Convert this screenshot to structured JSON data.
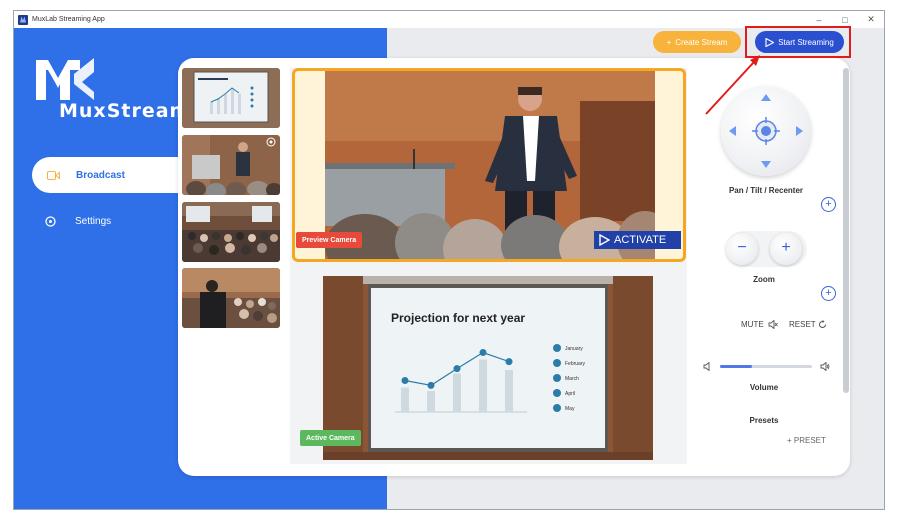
{
  "window": {
    "title": "MuxLab Streaming App",
    "controls": [
      "–",
      "□",
      "✕"
    ]
  },
  "brand": {
    "logo_text": "MuxStream"
  },
  "sidebar": {
    "items": [
      {
        "label": "Broadcast",
        "icon": "video-camera-icon",
        "active": true
      },
      {
        "label": "Settings",
        "icon": "settings-icon",
        "active": false
      }
    ]
  },
  "toolbar": {
    "create_label": "Create Stream",
    "start_label": "Start Streaming"
  },
  "preview": {
    "tag": "Preview Camera",
    "activate_label": "ACTIVATE"
  },
  "active": {
    "tag": "Active Camera"
  },
  "slide": {
    "title": "Projection for next year",
    "legend": [
      "January",
      "February",
      "March",
      "April",
      "May"
    ],
    "bars": [
      0.35,
      0.3,
      0.55,
      0.75,
      0.6
    ],
    "line": [
      0.45,
      0.38,
      0.62,
      0.85,
      0.72
    ]
  },
  "controls": {
    "ptz_label": "Pan / Tilt / Recenter",
    "zoom_label": "Zoom",
    "mute_label": "MUTE",
    "reset_label": "RESET",
    "volume_label": "Volume",
    "volume_level": 0.35,
    "presets_label": "Presets",
    "add_preset_label": "+ PRESET"
  },
  "colors": {
    "brand_blue": "#2f6fe8",
    "accent_orange": "#f7b33b",
    "start_blue": "#2a4fd1",
    "preview_red": "#e74a3b",
    "active_green": "#5cb85c",
    "highlight_red": "#e01c1c"
  }
}
